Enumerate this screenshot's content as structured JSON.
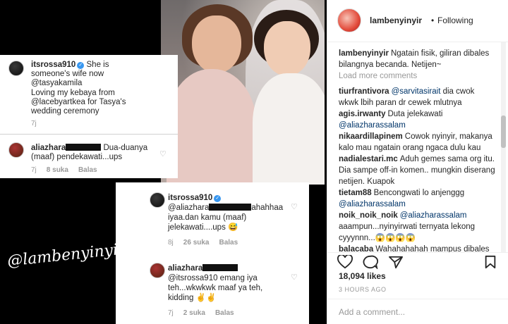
{
  "post": {
    "watermark": "@lambenyinyir",
    "card1": {
      "user": "itsrossa910",
      "verified_mark": "✓",
      "text_l1": "She is",
      "text_l2": "someone's wife now",
      "text_l3": "@tasyakamila",
      "text_l4": "Loving my kebaya from",
      "text_l5": "@lacebyartkea for Tasya's",
      "text_l6": "wedding ceremony",
      "time": "7j",
      "reply_user": "aliazhara",
      "reply_text_l1": "Dua-duanya",
      "reply_text_l2": "(maaf) pendekawati...ups",
      "reply_time": "7j",
      "reply_likes": "8 suka",
      "reply_action": "Balas"
    },
    "card2": {
      "user": "itsrossa910",
      "verified_mark": "✓",
      "text_l1": "@aliazhara",
      "text_l1b": "ahahhaa",
      "text_l2": "iyaa.dan kamu (maaf)",
      "text_l3": "jelekawati....ups 😅",
      "time": "8j",
      "likes": "26 suka",
      "action": "Balas",
      "reply_user": "aliazhara",
      "reply_text_l1": "@itsrossa910 emang iya",
      "reply_text_l2": "teh...wkwkwk maaf ya teh,",
      "reply_text_l3": "kidding ✌✌",
      "reply_time": "7j",
      "reply_likes": "2 suka",
      "reply_action": "Balas"
    }
  },
  "sidebar": {
    "header": {
      "username": "lambenyinyir",
      "separator": "•",
      "follow_status": "Following"
    },
    "caption": {
      "user": "lambenyinyir",
      "text": "Ngatain fisik, giliran dibales bilangnya becanda. Netijen~"
    },
    "load_more": "Load more comments",
    "comments": [
      {
        "user": "tiurfrantivora",
        "mention": "@sarvitasirait",
        "text": "dia cwok wkwk lbih paran dr cewek mlutnya"
      },
      {
        "user": "agis.irwanty",
        "mention": "",
        "text": "Duta jelekawati",
        "mention_after": "@aliazharassalam"
      },
      {
        "user": "nikaardillapinem",
        "mention": "",
        "text": "Cowok nyinyir, makanya kalo mau ngatain orang ngaca dulu kau"
      },
      {
        "user": "nadialestari.mc",
        "mention": "",
        "text": "Aduh gemes sama org itu. Dia sampe off-in komen.. mungkin diserang netijen. Kuapok"
      },
      {
        "user": "tietam88",
        "mention": "",
        "text": "Bencongwati lo anjenggg",
        "mention_after": "@aliazharassalam"
      },
      {
        "user": "noik_noik_noik",
        "mention": "@aliazharassalam",
        "text": "aaampun...nyinyirwati ternyata lekong cyyynnn...😱😱😱😱"
      },
      {
        "user": "balacaba",
        "mention": "",
        "text": "Wahahahahah mampus dibales"
      }
    ],
    "likes": "18,094 likes",
    "timestamp": "3 HOURS AGO",
    "add_comment_placeholder": "Add a comment..."
  },
  "icons": {
    "heart": "heart-icon",
    "comment": "comment-icon",
    "share": "share-icon",
    "bookmark": "bookmark-icon"
  },
  "colors": {
    "link": "#003569",
    "verified": "#3897f0",
    "muted": "#999999"
  }
}
